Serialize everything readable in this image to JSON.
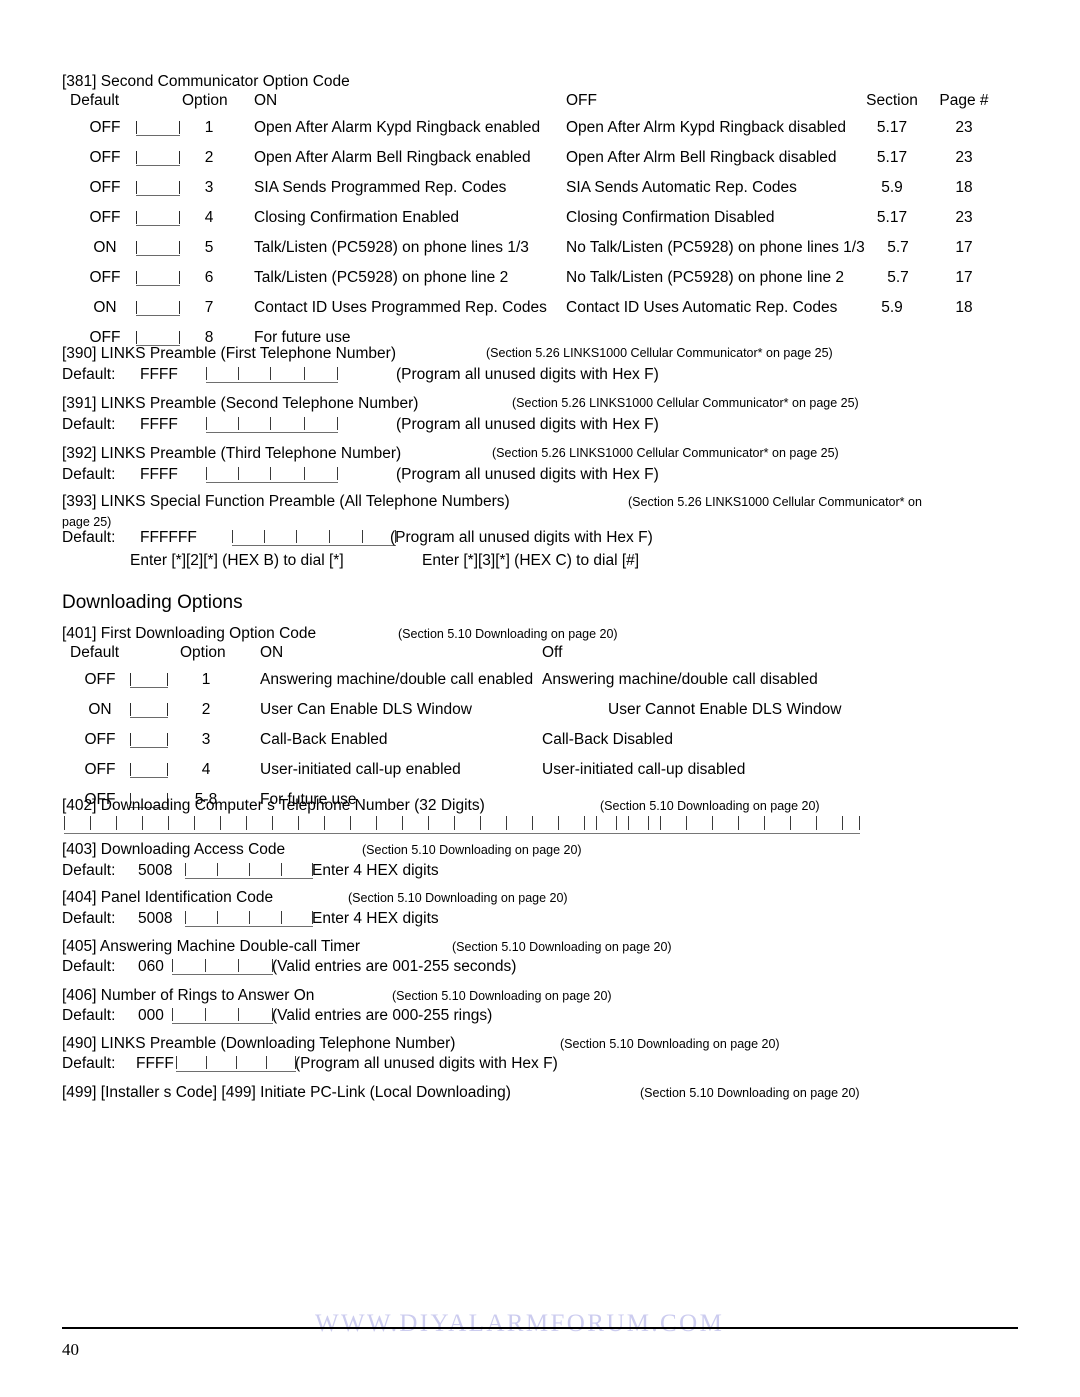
{
  "document": {
    "page_number": "40",
    "watermark": "WWW.DIYALARMFORUM.COM"
  },
  "section_381": {
    "title": "[381] Second Communicator Option Code",
    "headers": {
      "default": "Default",
      "option": "Option",
      "on": "ON",
      "off": "OFF",
      "section": "Section",
      "page": "Page #"
    },
    "rows": [
      {
        "default": "OFF",
        "num": "1",
        "on": "Open After Alarm Kypd Ringback enabled",
        "off": "Open After Alrm Kypd Ringback disabled",
        "section": "5.17",
        "page": "23"
      },
      {
        "default": "OFF",
        "num": "2",
        "on": "Open After Alarm Bell Ringback enabled",
        "off": "Open After Alrm Bell Ringback disabled",
        "section": "5.17",
        "page": "23"
      },
      {
        "default": "OFF",
        "num": "3",
        "on": "SIA Sends Programmed Rep. Codes",
        "off": "SIA Sends Automatic Rep. Codes",
        "section": "5.9",
        "page": "18"
      },
      {
        "default": "OFF",
        "num": "4",
        "on": "Closing Confirmation Enabled",
        "off": "Closing Confirmation Disabled",
        "section": "5.17",
        "page": "23"
      },
      {
        "default": "ON",
        "num": "5",
        "on": "Talk/Listen (PC5928) on phone lines 1/3",
        "off": "No Talk/Listen (PC5928) on phone lines 1/3",
        "section": "5.7",
        "page": "17"
      },
      {
        "default": "OFF",
        "num": "6",
        "on": "Talk/Listen (PC5928) on phone line 2",
        "off": "No Talk/Listen (PC5928) on phone line 2",
        "section": "5.7",
        "page": "17"
      },
      {
        "default": "ON",
        "num": "7",
        "on": "Contact ID Uses Programmed Rep. Codes",
        "off": "Contact ID Uses Automatic Rep. Codes",
        "section": "5.9",
        "page": "18"
      },
      {
        "default": "OFF",
        "num": "8",
        "on": "For future use",
        "off": "",
        "section": "",
        "page": ""
      }
    ]
  },
  "section_390": {
    "title": "[390] LINKS Preamble (First Telephone Number)",
    "reference": "(Section 5.26  LINKS1000 Cellular Communicator*   on page 25)",
    "default_label": "Default:",
    "default_value": "FFFF",
    "note": "(Program all unused digits with Hex F)"
  },
  "section_391": {
    "title": "[391] LINKS Preamble (Second Telephone Number)",
    "reference": "(Section 5.26  LINKS1000 Cellular Communicator*   on page 25)",
    "default_label": "Default:",
    "default_value": "FFFF",
    "note": "(Program all unused digits with Hex F)"
  },
  "section_392": {
    "title": "[392] LINKS Preamble (Third Telephone Number)",
    "reference": "(Section 5.26  LINKS1000 Cellular Communicator*   on page 25)",
    "default_label": "Default:",
    "default_value": "FFFF",
    "note": "(Program all unused digits with Hex F)"
  },
  "section_393": {
    "title": "[393] LINKS Special Function Preamble (All Telephone Numbers)",
    "reference": "(Section 5.26  LINKS1000 Cellular Communicator*   on",
    "reference_cont": "page 25)",
    "default_label": "Default:",
    "default_value": "FFFFFF",
    "note": "(Program all unused digits with Hex F)",
    "hint_left": "Enter [*][2][*] (HEX B) to dial [*]",
    "hint_right": "Enter [*][3][*] (HEX C) to dial [#]"
  },
  "downloading_heading": "Downloading Options",
  "section_401": {
    "title": "[401] First Downloading Option Code",
    "reference": "(Section 5.10  Downloading   on page 20)",
    "headers": {
      "default": "Default",
      "option": "Option",
      "on": "ON",
      "off": "Off"
    },
    "rows": [
      {
        "default": "OFF",
        "num": "1",
        "on": "Answering machine/double call enabled",
        "off": "Answering machine/double call disabled"
      },
      {
        "default": "ON",
        "num": "2",
        "on": "User Can Enable DLS Window",
        "off": "User Cannot Enable DLS Window"
      },
      {
        "default": "OFF",
        "num": "3",
        "on": "Call-Back Enabled",
        "off": "Call-Back Disabled"
      },
      {
        "default": "OFF",
        "num": "4",
        "on": "User-initiated call-up enabled",
        "off": "User-initiated call-up disabled"
      },
      {
        "default": "OFF",
        "num": "5-8",
        "on": "For future use",
        "off": ""
      }
    ]
  },
  "section_402": {
    "title": "[402] Downloading Computer s Telephone Number (32 Digits)",
    "reference": "(Section 5.10  Downloading   on page 20)"
  },
  "section_403": {
    "title": "[403] Downloading Access Code",
    "reference": "(Section 5.10  Downloading   on page 20)",
    "default_label": "Default:",
    "default_value": "5008",
    "note": "Enter 4 HEX digits"
  },
  "section_404": {
    "title": "[404] Panel Identification Code",
    "reference": "(Section 5.10  Downloading   on page 20)",
    "default_label": "Default:",
    "default_value": "5008",
    "note": "Enter 4 HEX digits"
  },
  "section_405": {
    "title": "[405] Answering Machine Double-call Timer",
    "reference": "(Section 5.10  Downloading   on page 20)",
    "default_label": "Default:",
    "default_value": "060",
    "note": "(Valid entries are 001-255 seconds)"
  },
  "section_406": {
    "title": "[406] Number of Rings to Answer On",
    "reference": "(Section 5.10  Downloading   on page 20)",
    "default_label": "Default:",
    "default_value": "000",
    "note": "(Valid entries are 000-255 rings)"
  },
  "section_490": {
    "title": "[490] LINKS Preamble (Downloading Telephone Number)",
    "reference": "(Section 5.10  Downloading   on page 20)",
    "default_label": "Default:",
    "default_value": "FFFF",
    "note": "(Program all unused digits with Hex F)"
  },
  "section_499": {
    "title": "[499] [Installer s Code] [499] Initiate PC-Link (Local Downloading)",
    "reference": "(Section 5.10  Downloading   on page 20)"
  }
}
